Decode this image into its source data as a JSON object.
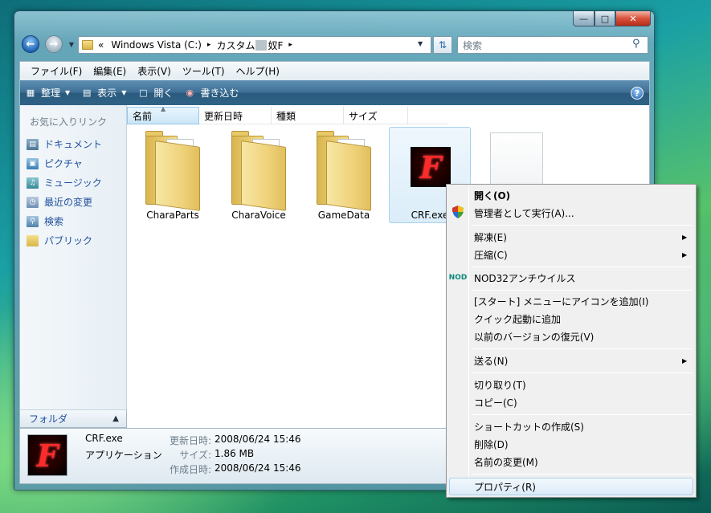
{
  "window": {
    "min_glyph": "—",
    "max_glyph": "□",
    "close_glyph": "✕"
  },
  "address": {
    "chevron": "«",
    "drive": "Windows Vista (C:)",
    "sep": "▸",
    "folder": "カスタム",
    "folder_suffix": "奴F"
  },
  "search": {
    "placeholder": "検索"
  },
  "menubar": {
    "items": [
      "ファイル(F)",
      "編集(E)",
      "表示(V)",
      "ツール(T)",
      "ヘルプ(H)"
    ]
  },
  "cmdbar": {
    "organize": "整理",
    "view": "表示",
    "open": "開く",
    "burn": "書き込む"
  },
  "sidebar": {
    "header": "お気に入りリンク",
    "items": [
      "ドキュメント",
      "ピクチャ",
      "ミュージック",
      "最近の変更",
      "検索",
      "パブリック"
    ],
    "folders_label": "フォルダ"
  },
  "columns": [
    "名前",
    "更新日時",
    "種類",
    "サイズ"
  ],
  "files": [
    {
      "name": "CharaParts",
      "type": "folder"
    },
    {
      "name": "CharaVoice",
      "type": "folder"
    },
    {
      "name": "GameData",
      "type": "folder"
    },
    {
      "name": "CRF.exe",
      "type": "exe",
      "selected": true
    }
  ],
  "details": {
    "name": "CRF.exe",
    "type": "アプリケーション",
    "modified_label": "更新日時:",
    "modified": "2008/06/24 15:46",
    "size_label": "サイズ:",
    "size": "1.86 MB",
    "created_label": "作成日時:",
    "created": "2008/06/24 15:46"
  },
  "logo_letter": "F",
  "context_menu": {
    "open": "開く(O)",
    "run_as_admin": "管理者として実行(A)...",
    "extract": "解凍(E)",
    "compress": "圧縮(C)",
    "nod32": "NOD32アンチウイルス",
    "pin_start": "[スタート] メニューにアイコンを追加(I)",
    "add_quick_launch": "クイック起動に追加",
    "restore_versions": "以前のバージョンの復元(V)",
    "send_to": "送る(N)",
    "cut": "切り取り(T)",
    "copy": "コピー(C)",
    "create_shortcut": "ショートカットの作成(S)",
    "delete": "削除(D)",
    "rename": "名前の変更(M)",
    "properties": "プロパティ(R)"
  }
}
